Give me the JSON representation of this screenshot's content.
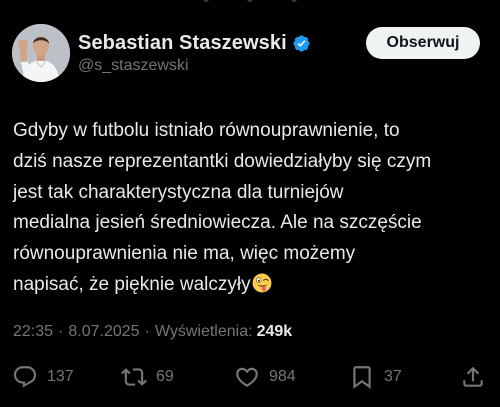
{
  "author": {
    "display_name": "Sebastian Staszewski",
    "handle": "@s_staszewski",
    "verified": true,
    "verified_color": "#1d9bf0"
  },
  "follow_button": {
    "label": "Obserwuj"
  },
  "tweet": {
    "text": "Gdyby w futbolu istniało równouprawnienie, to\ndziś nasze reprezentantki dowiedziałyby się czym\njest tak charakterystyczna dla turniejów\nmedialna jesień średniowiecza. Ale na szczęście\nrównouprawnienia nie ma, więc możemy\nnapisać, że pięknie walczyły",
    "trailing_emoji": "zany-face"
  },
  "meta": {
    "time": "22:35",
    "separator": "·",
    "date": "8.07.2025",
    "views_label": "Wyświetlenia:",
    "views_count": "249k"
  },
  "actions": {
    "replies": "137",
    "reposts": "69",
    "likes": "984",
    "bookmarks": "37"
  },
  "colors": {
    "background": "#000000",
    "primary_text": "#e7e9ea",
    "secondary_text": "#71767b",
    "button_bg": "#eff3f4",
    "button_text": "#0f1419"
  }
}
